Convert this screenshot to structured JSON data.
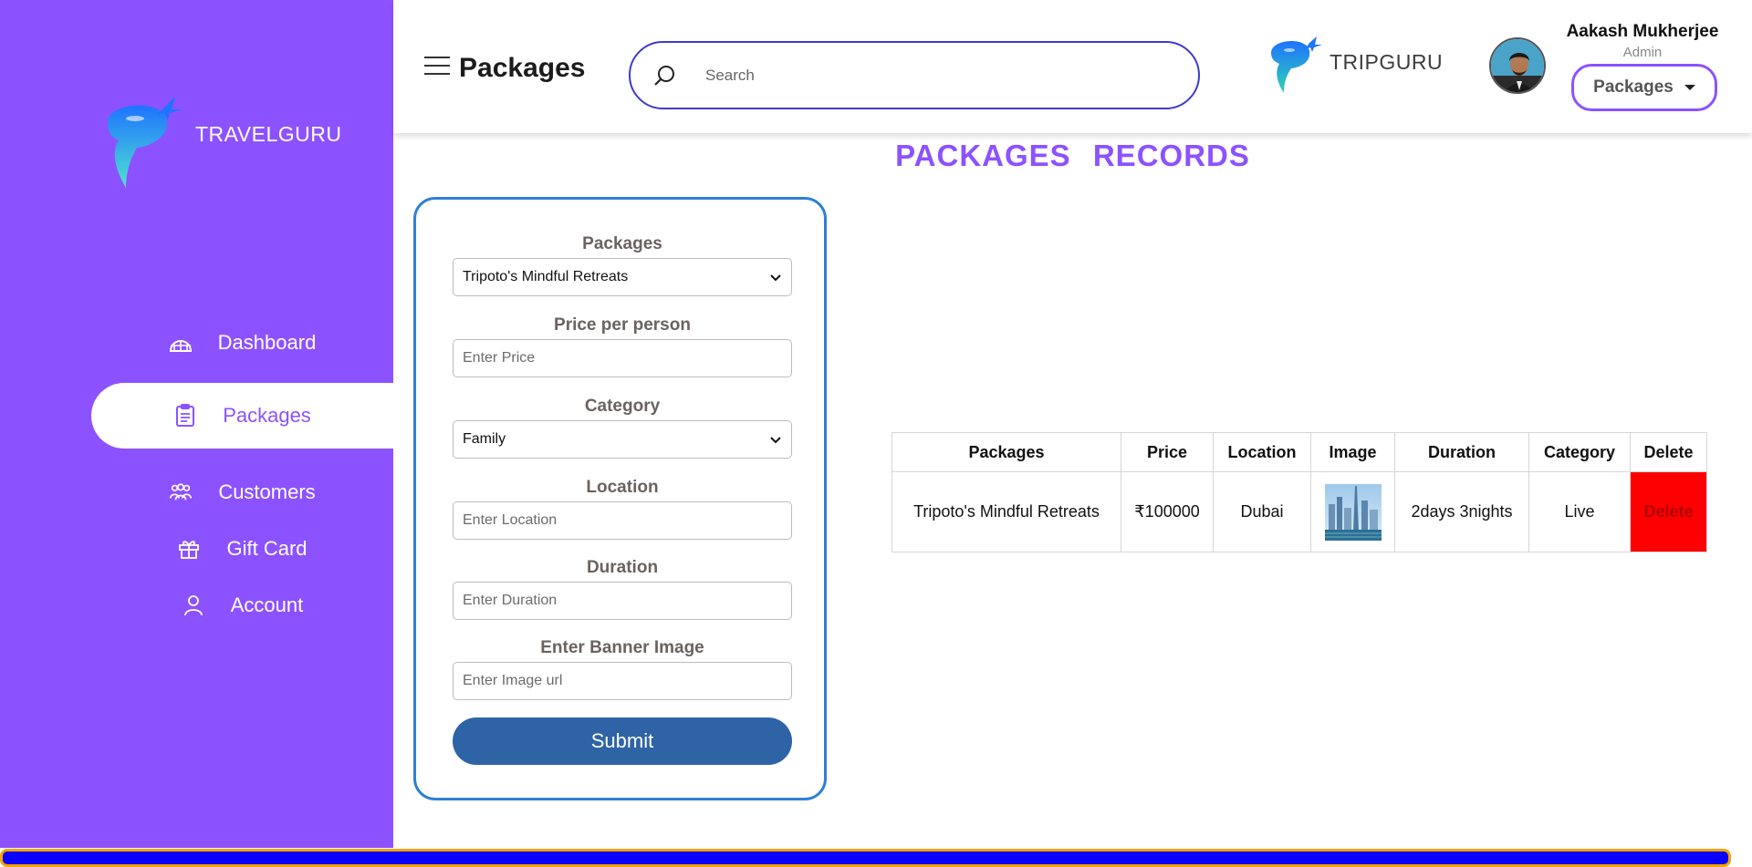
{
  "brand": {
    "name": "TRAVELGURU"
  },
  "sidebar": {
    "items": [
      {
        "label": "Dashboard",
        "icon": "dashboard-icon"
      },
      {
        "label": "Packages",
        "icon": "clipboard-icon",
        "active": true
      },
      {
        "label": "Customers",
        "icon": "customers-icon"
      },
      {
        "label": "Gift Card",
        "icon": "gift-icon"
      },
      {
        "label": "Account",
        "icon": "user-icon"
      }
    ]
  },
  "header": {
    "title": "Packages",
    "search_placeholder": "Search",
    "partner_logo": "TRIPGURU",
    "user": {
      "name": "Aakash Mukherjee",
      "role": "Admin"
    },
    "dropdown_label": "Packages"
  },
  "records_title": "PACKAGES RECORDS",
  "form": {
    "packages": {
      "label": "Packages",
      "selected": "Tripoto's Mindful Retreats"
    },
    "price": {
      "label": "Price per person",
      "placeholder": "Enter Price"
    },
    "category": {
      "label": "Category",
      "selected": "Family"
    },
    "location": {
      "label": "Location",
      "placeholder": "Enter Location"
    },
    "duration": {
      "label": "Duration",
      "placeholder": "Enter Duration"
    },
    "banner": {
      "label": "Enter Banner Image",
      "placeholder": "Enter Image url"
    },
    "submit_label": "Submit"
  },
  "table": {
    "headers": [
      "Packages",
      "Price",
      "Location",
      "Image",
      "Duration",
      "Category",
      "Delete"
    ],
    "rows": [
      {
        "package": "Tripoto's Mindful Retreats",
        "price": "₹100000",
        "location": "Dubai",
        "image": "dubai-skyline-thumbnail",
        "duration": "2days 3nights",
        "category": "Live",
        "delete": "Delete"
      }
    ]
  },
  "colors": {
    "sidebar": "#8c52ff",
    "accent": "#8c52ff",
    "search_border": "#3f3bcb",
    "form_border": "#2f80d5",
    "submit": "#2e64a5",
    "delete": "#ff0000",
    "bottom_bar": "#0a00ff",
    "bottom_bar_border": "#f5a300"
  }
}
